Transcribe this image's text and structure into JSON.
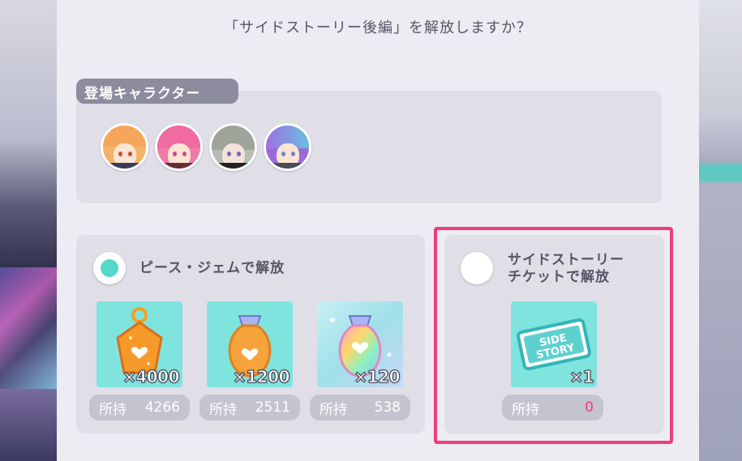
{
  "dialog": {
    "question": "「サイドストーリー後編」を解放しますか？"
  },
  "characters": {
    "tag": "登場キャラクター",
    "avatars": [
      "character-avatar-1",
      "character-avatar-2",
      "character-avatar-3",
      "character-avatar-4"
    ]
  },
  "option_gems": {
    "label": "ピース・ジェムで解放",
    "selected": true,
    "items": [
      {
        "quantity": "×4000",
        "owned_label": "所持",
        "owned": "4266"
      },
      {
        "quantity": "×1200",
        "owned_label": "所持",
        "owned": "2511"
      },
      {
        "quantity": "×120",
        "owned_label": "所持",
        "owned": "538"
      }
    ]
  },
  "option_ticket": {
    "label_line1": "サイドストーリー",
    "label_line2": "チケットで解放",
    "selected": false,
    "ticket_text_1": "SIDE",
    "ticket_text_2": "STORY",
    "quantity": "×1",
    "owned_label": "所持",
    "owned": "0"
  },
  "colors": {
    "accent": "#55d8c8",
    "highlight": "#ee3e7a",
    "panel": "#e0dfe8"
  }
}
